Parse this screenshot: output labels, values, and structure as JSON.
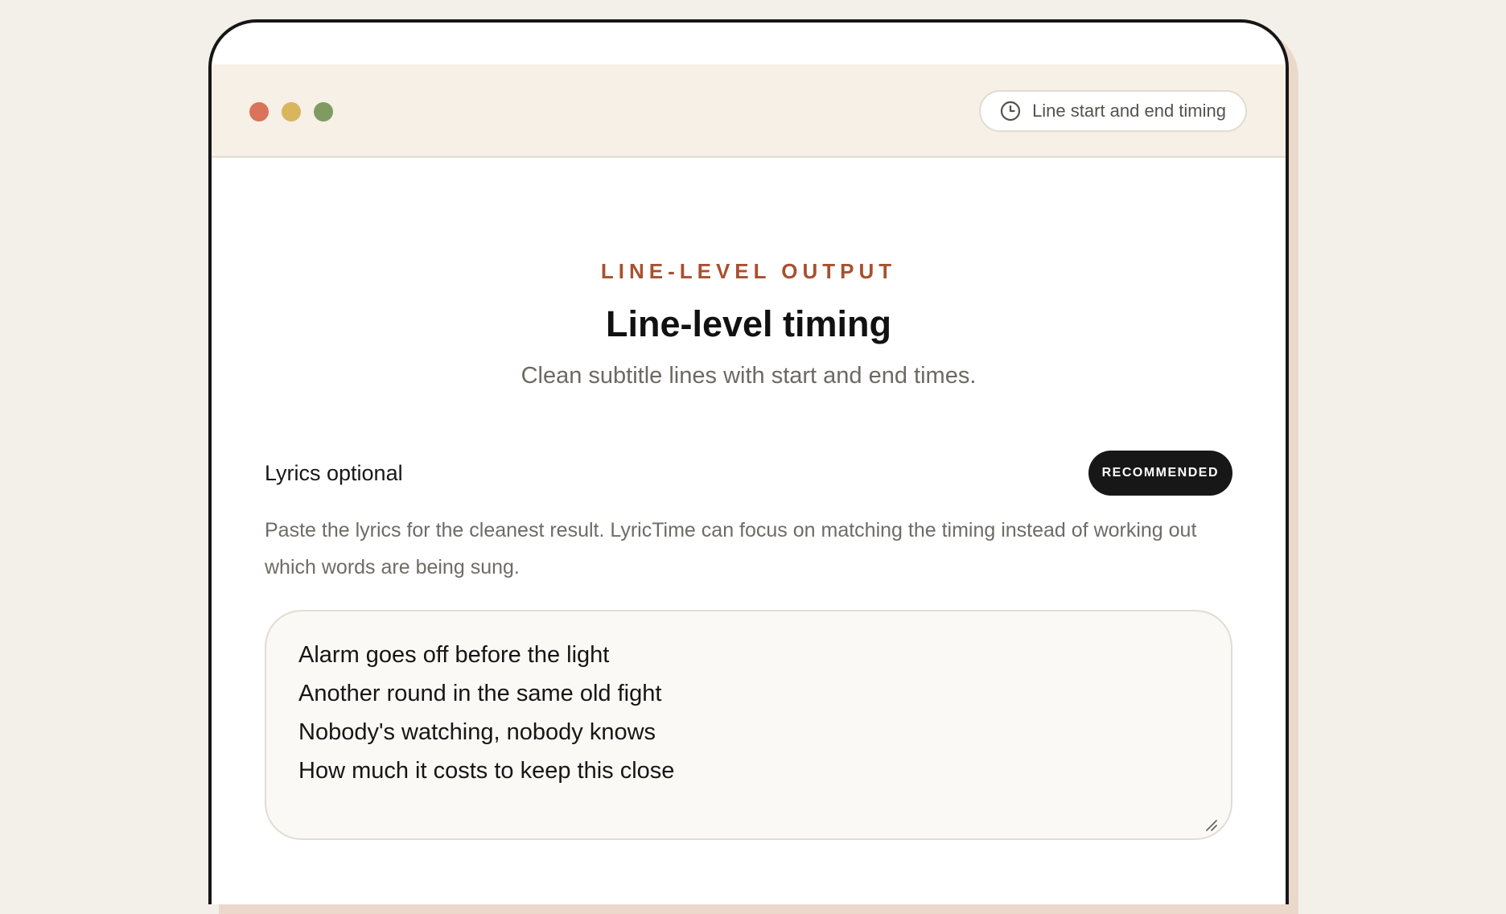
{
  "window": {
    "controls": [
      {
        "name": "close",
        "color": "#d9735a"
      },
      {
        "name": "minimize",
        "color": "#d9b55e"
      },
      {
        "name": "maximize",
        "color": "#7f9b62"
      }
    ]
  },
  "header": {
    "timing_chip": {
      "icon": "clock-icon",
      "label": "Line start and end timing"
    }
  },
  "main": {
    "eyebrow": "LINE-LEVEL OUTPUT",
    "title": "Line-level timing",
    "subtitle": "Clean subtitle lines with start and end times."
  },
  "lyrics_section": {
    "label": "Lyrics optional",
    "badge": "RECOMMENDED",
    "help_text": "Paste the lyrics for the cleanest result. LyricTime can focus on matching the timing instead of working out which words are being sung.",
    "value": "Alarm goes off before the light\nAnother round in the same old fight\nNobody's watching, nobody knows\nHow much it costs to keep this close"
  },
  "colors": {
    "accent": "#a8502f",
    "badge_bg": "#171717",
    "top_bar_bg": "#f6f0e6",
    "page_bg": "#f3f0ea"
  }
}
